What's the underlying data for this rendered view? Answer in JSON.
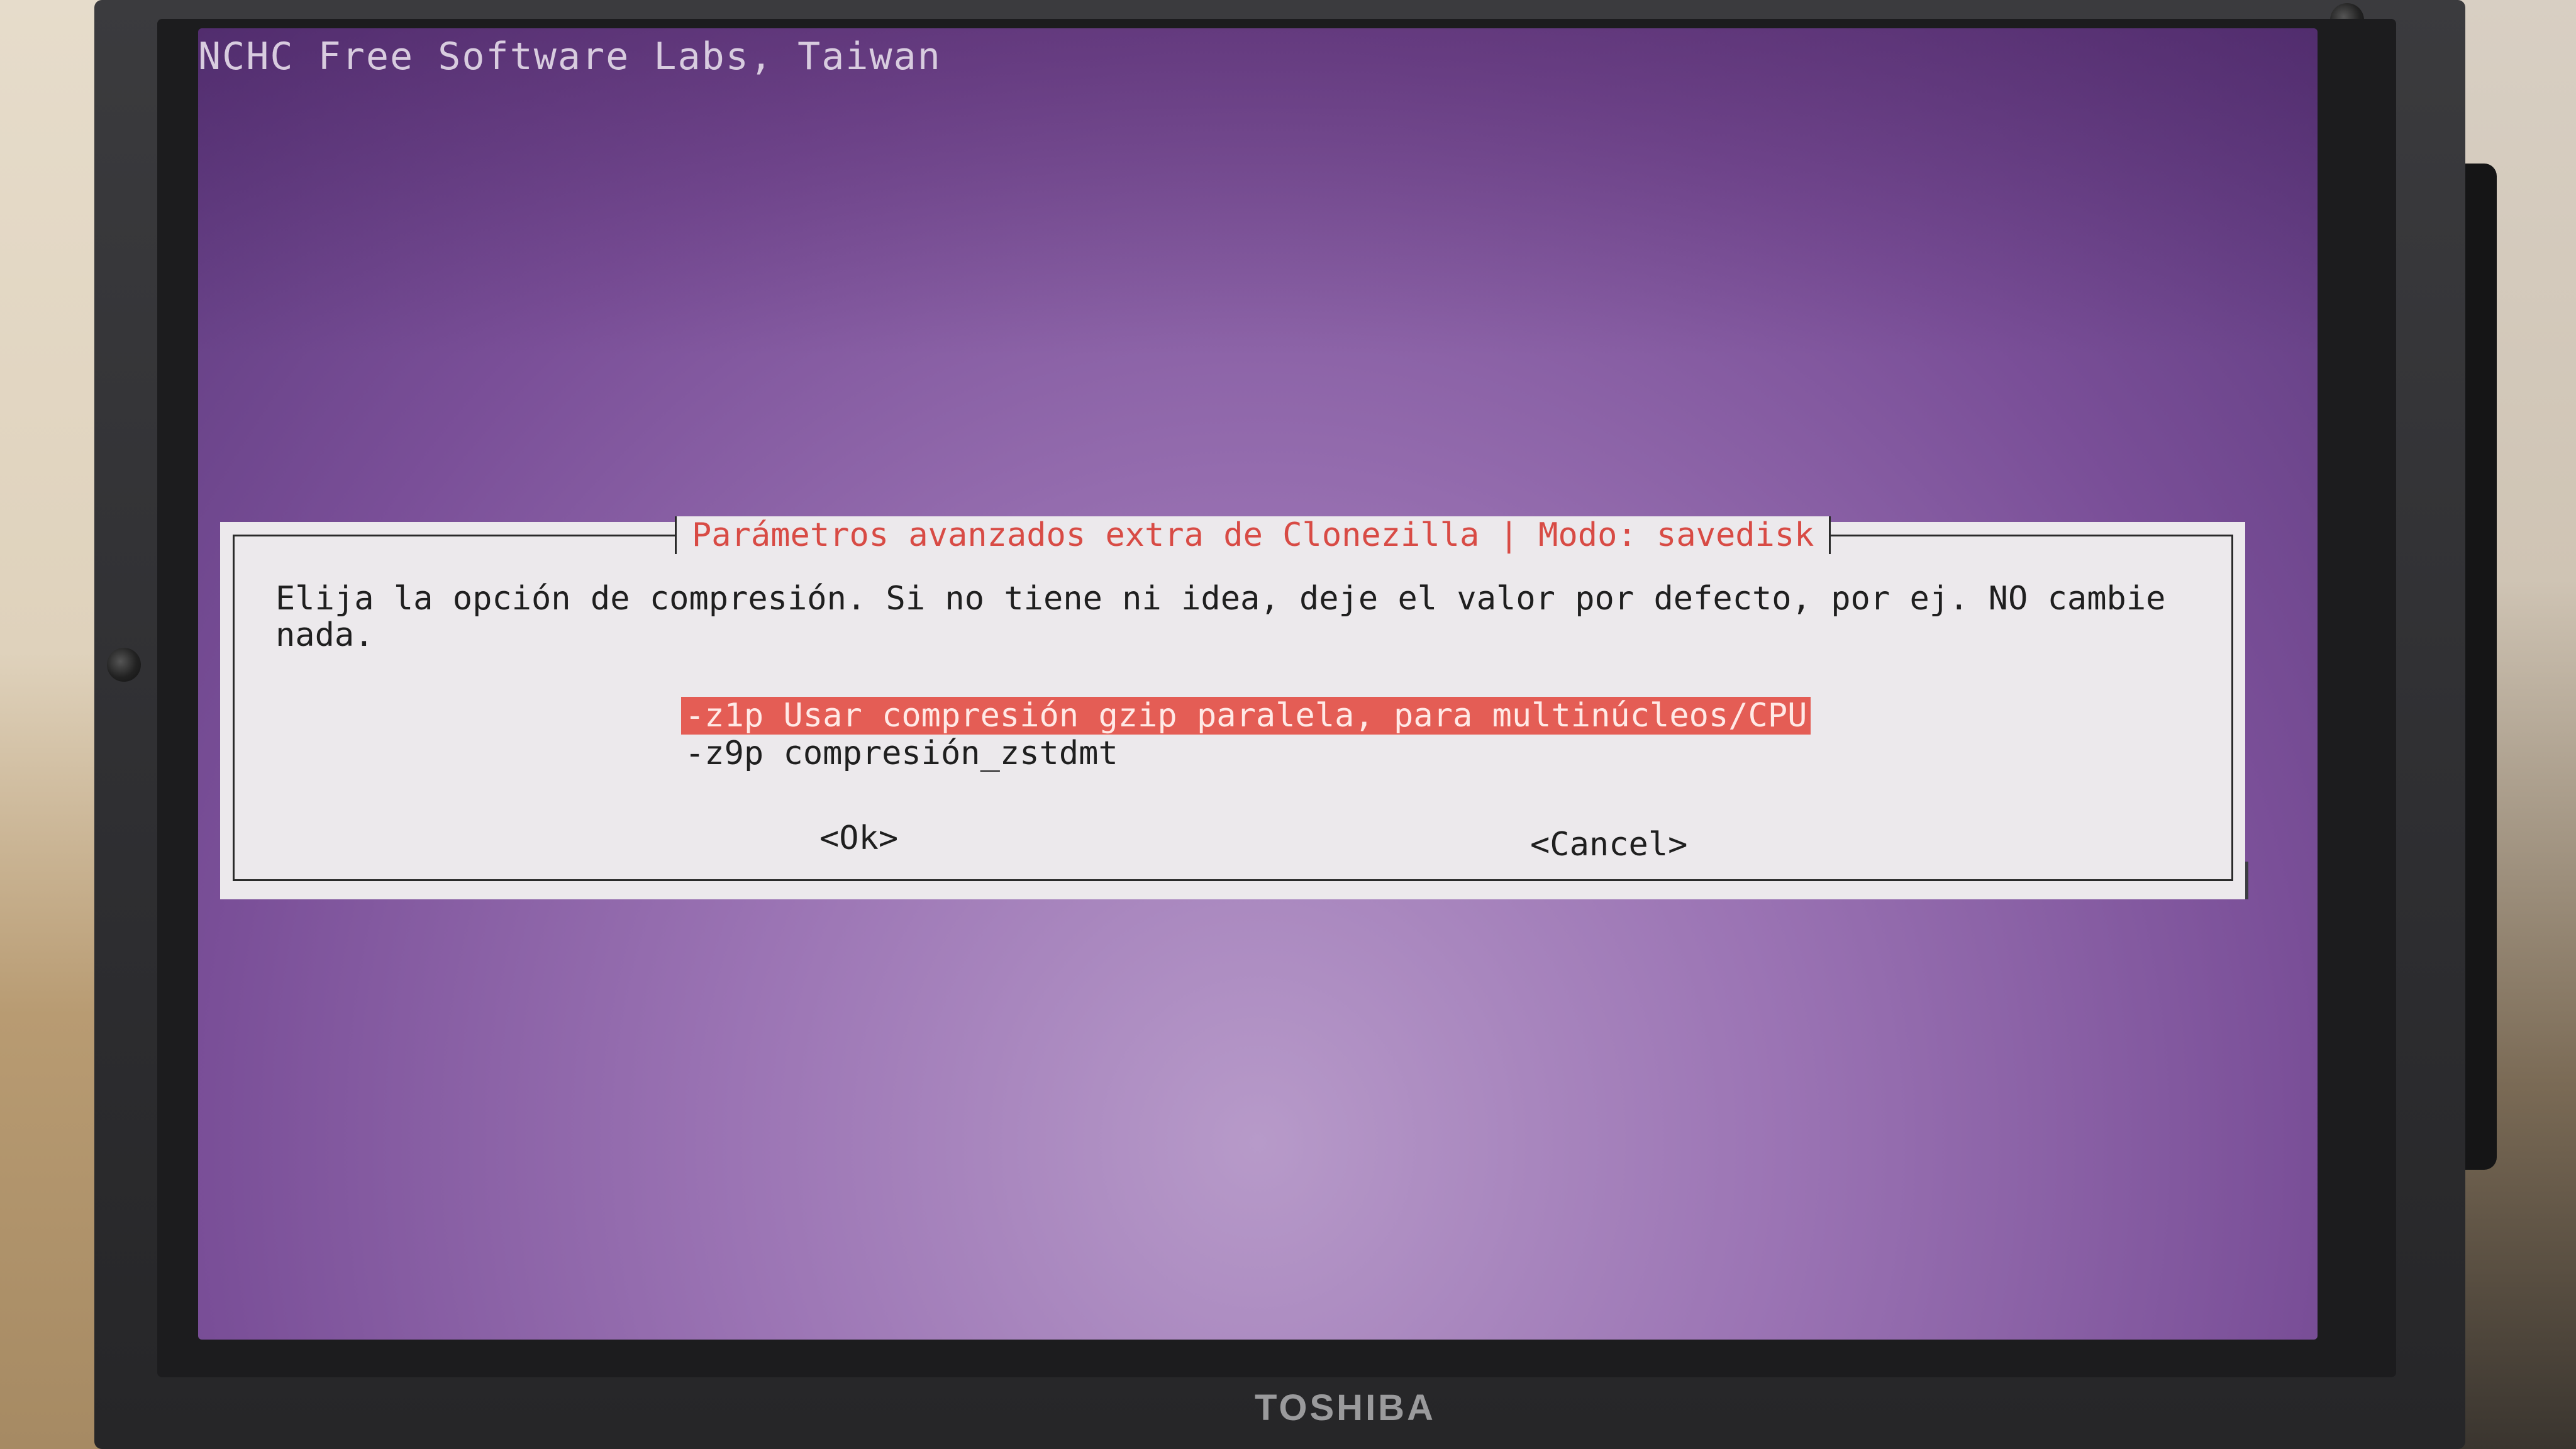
{
  "screen": {
    "header": "NCHC Free Software Labs, Taiwan"
  },
  "dialog": {
    "title": "Parámetros avanzados extra de Clonezilla | Modo: savedisk",
    "prompt": "Elija la opción de compresión. Si no tiene ni idea, deje el valor por defecto, por ej. NO cambie nada.",
    "options": [
      {
        "label": "-z1p Usar compresión gzip paralela, para multinúcleos/CPU",
        "selected": true
      },
      {
        "label": "-z9p compresión_zstdmt",
        "selected": false
      }
    ],
    "ok_label": "<Ok>",
    "cancel_label": "<Cancel>"
  },
  "bezel": {
    "brand": "TOSHIBA"
  },
  "colors": {
    "selection": "#e45d55",
    "title_text": "#d84b45",
    "dialog_bg": "#ece9ec",
    "screen_purple": "#7a4f98"
  }
}
